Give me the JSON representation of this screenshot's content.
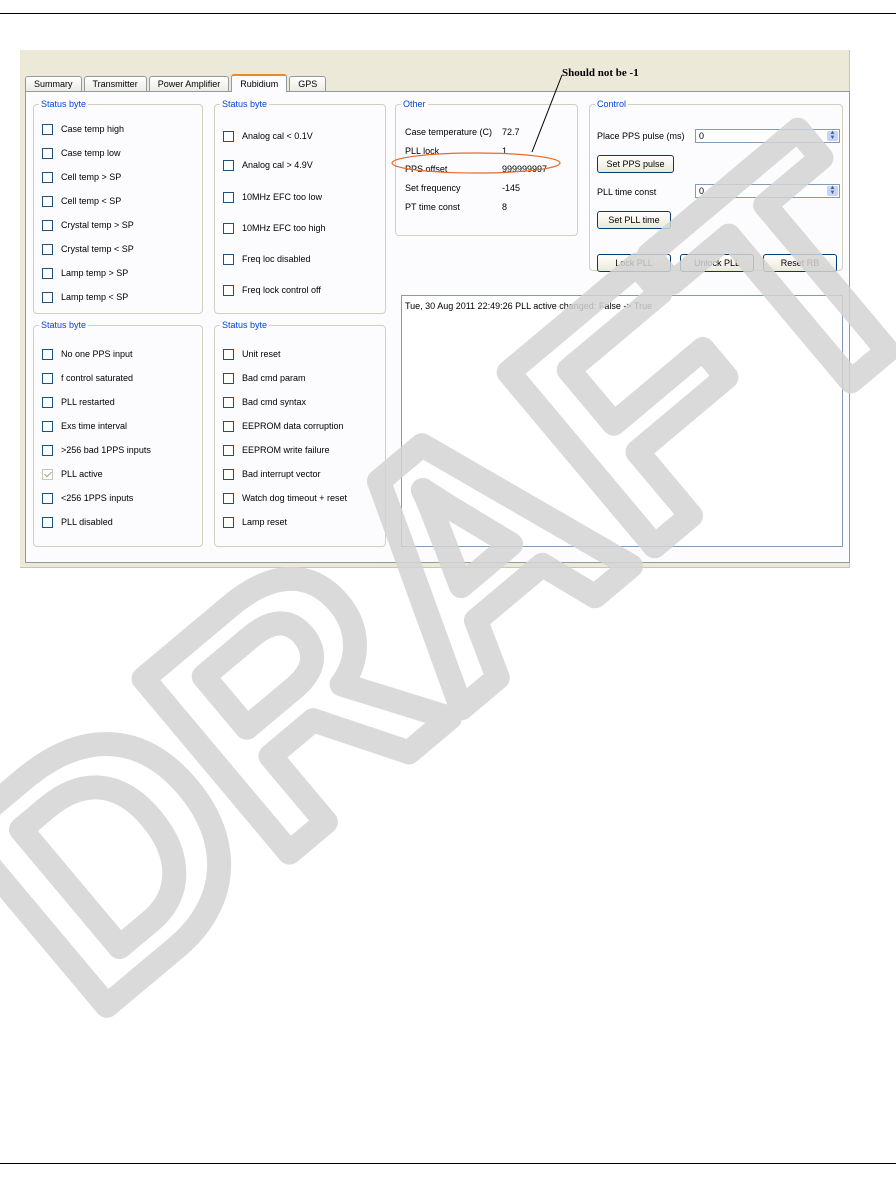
{
  "annotation": {
    "note": "Should not be -1"
  },
  "tabs": [
    {
      "label": "Summary",
      "active": false
    },
    {
      "label": "Transmitter",
      "active": false
    },
    {
      "label": "Power Amplifier",
      "active": false
    },
    {
      "label": "Rubidium",
      "active": true
    },
    {
      "label": "GPS",
      "active": false
    }
  ],
  "status_groups": [
    {
      "legend": "Status byte",
      "items": [
        {
          "label": "Case temp high",
          "checked": false
        },
        {
          "label": "Case temp low",
          "checked": false
        },
        {
          "label": "Cell temp > SP",
          "checked": false
        },
        {
          "label": "Cell temp < SP",
          "checked": false
        },
        {
          "label": "Crystal temp > SP",
          "checked": false
        },
        {
          "label": "Crystal temp < SP",
          "checked": false
        },
        {
          "label": "Lamp temp > SP",
          "checked": false
        },
        {
          "label": "Lamp temp < SP",
          "checked": false
        }
      ]
    },
    {
      "legend": "Status byte",
      "items": [
        {
          "label": "Analog cal < 0.1V",
          "checked": false
        },
        {
          "label": "Analog cal > 4.9V",
          "checked": false
        },
        {
          "label": "10MHz EFC too low",
          "checked": false
        },
        {
          "label": "10MHz EFC too high",
          "checked": false
        },
        {
          "label": "Freq loc disabled",
          "checked": false
        },
        {
          "label": "Freq lock control off",
          "checked": false
        }
      ]
    },
    {
      "legend": "Status byte",
      "items": [
        {
          "label": "No one PPS input",
          "checked": false
        },
        {
          "label": "f control saturated",
          "checked": false
        },
        {
          "label": "PLL restarted",
          "checked": false
        },
        {
          "label": "Exs time interval",
          "checked": false
        },
        {
          "label": ">256 bad 1PPS inputs",
          "checked": false
        },
        {
          "label": "PLL active",
          "checked": true
        },
        {
          "label": "<256 1PPS inputs",
          "checked": false
        },
        {
          "label": "PLL disabled",
          "checked": false
        }
      ]
    },
    {
      "legend": "Status byte",
      "items": [
        {
          "label": "Unit reset",
          "checked": false
        },
        {
          "label": "Bad cmd param",
          "checked": false
        },
        {
          "label": "Bad cmd syntax",
          "checked": false
        },
        {
          "label": "EEPROM data corruption",
          "checked": false
        },
        {
          "label": "EEPROM write failure",
          "checked": false
        },
        {
          "label": "Bad interrupt vector",
          "checked": false
        },
        {
          "label": "Watch dog timeout + reset",
          "checked": false
        },
        {
          "label": "Lamp reset",
          "checked": false
        }
      ]
    }
  ],
  "other": {
    "legend": "Other",
    "rows": [
      {
        "key": "Case temperature (C)",
        "value": "72.7"
      },
      {
        "key": "PLL lock",
        "value": "1"
      },
      {
        "key": "PPS offset",
        "value": "999999997"
      },
      {
        "key": "Set frequency",
        "value": "-145"
      },
      {
        "key": "PT time const",
        "value": "8"
      }
    ]
  },
  "control": {
    "legend": "Control",
    "pps_label": "Place PPS pulse (ms)",
    "pps_value": "0",
    "set_pps": "Set PPS pulse",
    "pll_label": "PLL time const",
    "pll_value": "0",
    "set_pll": "Set PLL time",
    "lock": "Lock PLL",
    "unlock": "Unlock PLL",
    "reset": "Reset RB"
  },
  "log": {
    "text": "Tue, 30 Aug 2011 22:49:26 PLL active changed: False -> True"
  },
  "watermark": "DRAFT"
}
